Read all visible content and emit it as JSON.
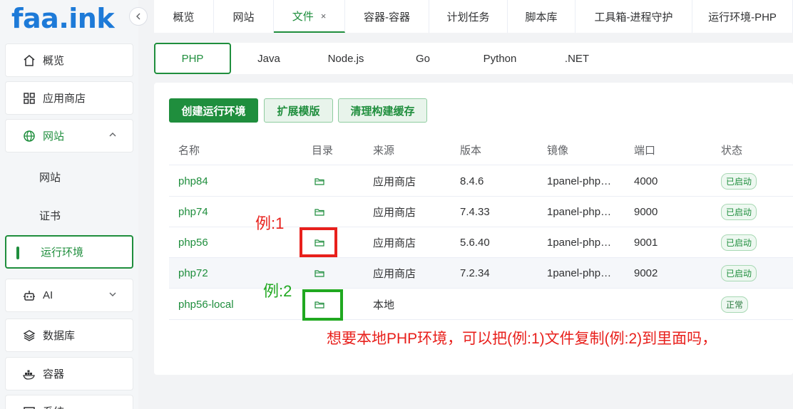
{
  "logo": "faa.ink",
  "sidebar": {
    "items": [
      {
        "label": "概览"
      },
      {
        "label": "应用商店"
      },
      {
        "label": "网站"
      },
      {
        "label": "AI"
      },
      {
        "label": "数据库"
      },
      {
        "label": "容器"
      },
      {
        "label": "系统"
      }
    ],
    "sub_items": [
      {
        "label": "网站"
      },
      {
        "label": "证书"
      },
      {
        "label": "运行环境"
      }
    ]
  },
  "top_tabs": [
    {
      "label": "概览"
    },
    {
      "label": "网站"
    },
    {
      "label": "文件",
      "close": "×"
    },
    {
      "label": "容器-容器"
    },
    {
      "label": "计划任务"
    },
    {
      "label": "脚本库"
    },
    {
      "label": "工具箱-进程守护"
    },
    {
      "label": "运行环境-PHP"
    }
  ],
  "runtime_tabs": [
    "PHP",
    "Java",
    "Node.js",
    "Go",
    "Python",
    ".NET"
  ],
  "toolbar": {
    "create": "创建运行环境",
    "extensions": "扩展模版",
    "clear_cache": "清理构建缓存"
  },
  "table": {
    "headers": [
      "名称",
      "目录",
      "来源",
      "版本",
      "镜像",
      "端口",
      "状态"
    ],
    "rows": [
      {
        "name": "php84",
        "source": "应用商店",
        "version": "8.4.6",
        "image": "1panel-php…",
        "port": "4000",
        "status": "已启动"
      },
      {
        "name": "php74",
        "source": "应用商店",
        "version": "7.4.33",
        "image": "1panel-php…",
        "port": "9000",
        "status": "已启动"
      },
      {
        "name": "php56",
        "source": "应用商店",
        "version": "5.6.40",
        "image": "1panel-php…",
        "port": "9001",
        "status": "已启动"
      },
      {
        "name": "php72",
        "source": "应用商店",
        "version": "7.2.34",
        "image": "1panel-php…",
        "port": "9002",
        "status": "已启动"
      },
      {
        "name": "php56-local",
        "source": "本地",
        "version": "",
        "image": "",
        "port": "",
        "status": "正常"
      }
    ]
  },
  "annotations": {
    "example1": "例:1",
    "example2": "例:2",
    "question": "想要本地PHP环境，可以把(例:1)文件复制(例:2)到里面吗，"
  },
  "colors": {
    "accent": "#1f8e3d",
    "logo": "#1d7ad8",
    "annotation_red": "#e8201c",
    "annotation_green": "#20a820"
  }
}
